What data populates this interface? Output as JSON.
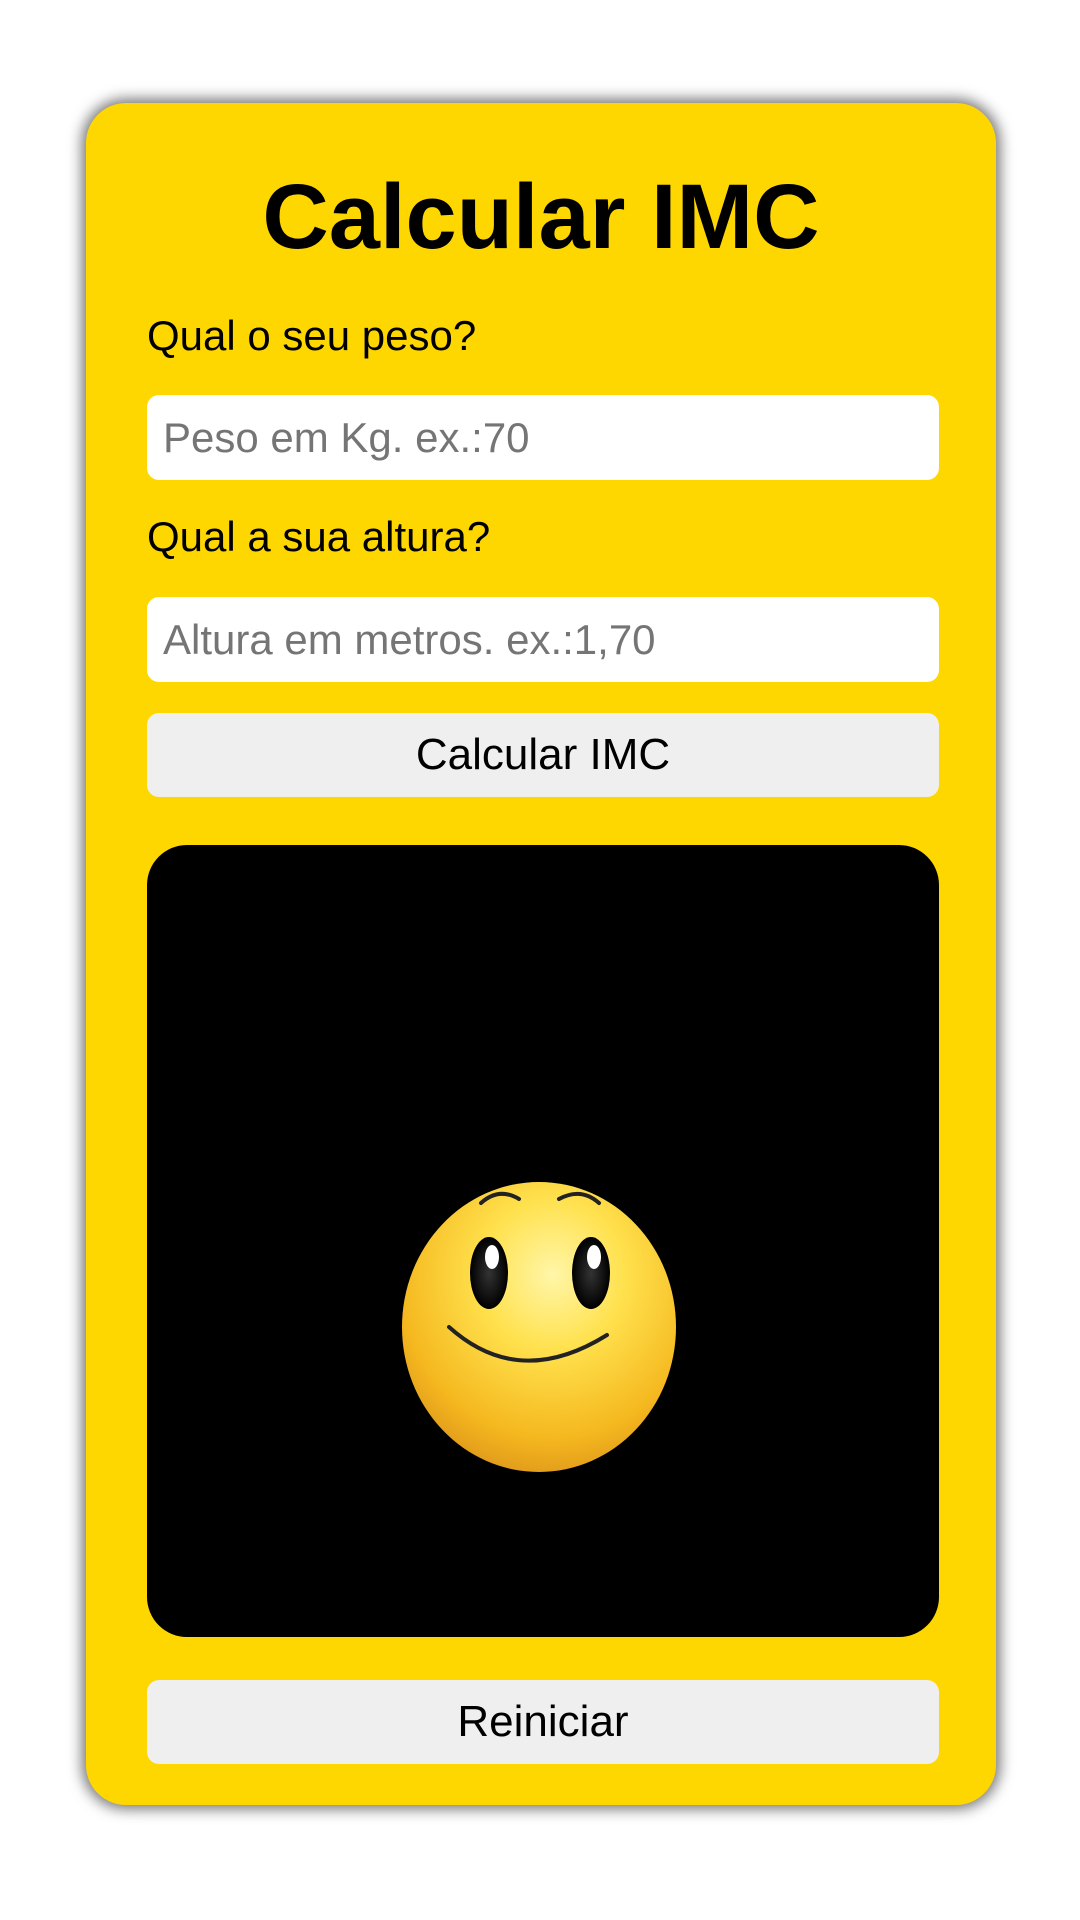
{
  "title": "Calcular IMC",
  "form": {
    "weight_label": "Qual o seu peso?",
    "weight_placeholder": "Peso em Kg. ex.:70",
    "weight_value": "",
    "height_label": "Qual a sua altura?",
    "height_placeholder": "Altura em metros. ex.:1,70",
    "height_value": "",
    "calculate_label": "Calcular IMC"
  },
  "result": {
    "image": "smiley-face-icon",
    "background_color": "#000000"
  },
  "reset_label": "Reiniciar",
  "colors": {
    "card": "#FFD700",
    "button": "#EFEFEF",
    "input": "#FFFFFF"
  }
}
